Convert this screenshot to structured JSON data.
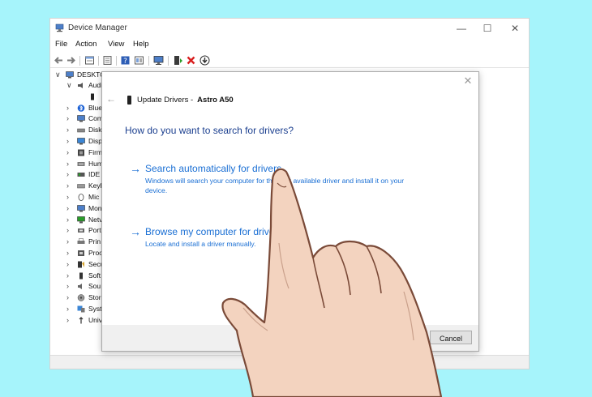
{
  "window": {
    "title": "Device Manager",
    "minimize_glyph": "—",
    "maximize_glyph": "☐",
    "close_glyph": "✕"
  },
  "menu": [
    "File",
    "Action",
    "View",
    "Help"
  ],
  "toolbar_icons": [
    "back-icon",
    "forward-icon",
    "properties-icon",
    "driver-icon",
    "help-icon",
    "view-icon",
    "monitor-icon",
    "update-driver-icon",
    "uninstall-icon",
    "download-icon"
  ],
  "tree": {
    "root": "DESKTO",
    "items": [
      {
        "label": "Audi",
        "icon": "speaker-icon",
        "expanded": true
      },
      {
        "label": "",
        "icon": "headset-icon",
        "child": true
      },
      {
        "label": "Blue",
        "icon": "bluetooth-icon"
      },
      {
        "label": "Com",
        "icon": "computer-icon"
      },
      {
        "label": "Disk",
        "icon": "disk-icon"
      },
      {
        "label": "Disp",
        "icon": "display-icon"
      },
      {
        "label": "Firm",
        "icon": "firmware-icon"
      },
      {
        "label": "Hum",
        "icon": "hid-icon"
      },
      {
        "label": "IDE",
        "icon": "ide-icon"
      },
      {
        "label": "Keyl",
        "icon": "keyboard-icon"
      },
      {
        "label": "Mic",
        "icon": "mouse-icon"
      },
      {
        "label": "Mon",
        "icon": "monitor-icon"
      },
      {
        "label": "Netv",
        "icon": "network-icon"
      },
      {
        "label": "Port",
        "icon": "port-icon"
      },
      {
        "label": "Prin",
        "icon": "printer-icon"
      },
      {
        "label": "Proc",
        "icon": "processor-icon"
      },
      {
        "label": "Secu",
        "icon": "security-icon"
      },
      {
        "label": "Soft",
        "icon": "software-icon"
      },
      {
        "label": "Sou",
        "icon": "sound-icon"
      },
      {
        "label": "Stor",
        "icon": "storage-icon"
      },
      {
        "label": "Syst",
        "icon": "system-icon"
      },
      {
        "label": "Univ",
        "icon": "usb-icon"
      }
    ]
  },
  "dialog": {
    "title": "Update Drivers -",
    "device": "Astro A50",
    "heading": "How do you want to search for drivers?",
    "options": [
      {
        "title": "Search automatically for drivers",
        "desc": "Windows will search your computer for the best available driver and install it on your device."
      },
      {
        "title": "Browse my computer for drivers",
        "desc": "Locate and install a driver manually."
      }
    ],
    "cancel": "Cancel",
    "close_glyph": "✕",
    "back_glyph": "←",
    "option_arrow": "→"
  },
  "colors": {
    "background": "#a6f4fb",
    "link_blue": "#1a6fd4",
    "heading_blue": "#1b3f8f",
    "skin": "#f3d3bf"
  }
}
